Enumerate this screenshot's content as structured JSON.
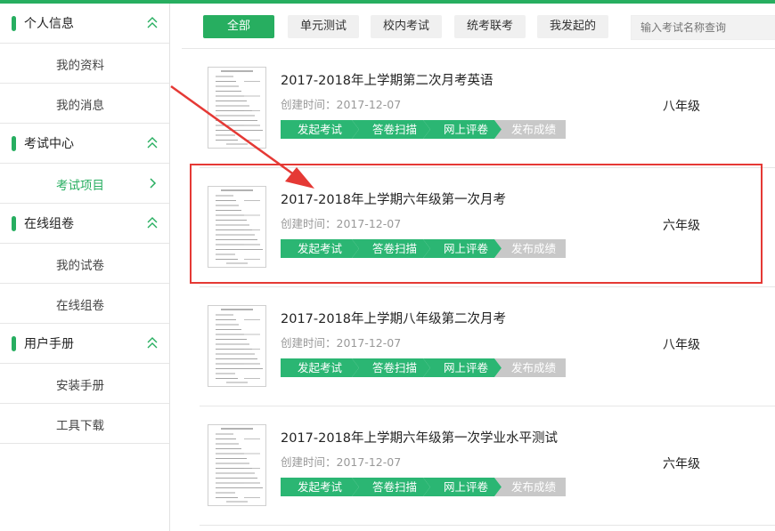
{
  "sidebar": {
    "sections": [
      {
        "label": "个人信息",
        "items": [
          {
            "label": "我的资料",
            "active": false
          },
          {
            "label": "我的消息",
            "active": false
          }
        ]
      },
      {
        "label": "考试中心",
        "items": [
          {
            "label": "考试项目",
            "active": true
          }
        ]
      },
      {
        "label": "在线组卷",
        "items": [
          {
            "label": "我的试卷",
            "active": false
          },
          {
            "label": "在线组卷",
            "active": false
          }
        ]
      },
      {
        "label": "用户手册",
        "items": [
          {
            "label": "安装手册",
            "active": false
          },
          {
            "label": "工具下载",
            "active": false
          }
        ]
      }
    ]
  },
  "filters": {
    "tabs": [
      "全部",
      "单元测试",
      "校内考试",
      "统考联考",
      "我发起的"
    ],
    "active_tab": "全部",
    "search_placeholder": "输入考试名称查询"
  },
  "steps": [
    "发起考试",
    "答卷扫描",
    "网上评卷",
    "发布成绩"
  ],
  "exams": [
    {
      "title": "2017-2018年上学期第二次月考英语",
      "date": "创建时间：2017-12-07",
      "grade": "八年级",
      "completed_steps": 3
    },
    {
      "title": "2017-2018年上学期六年级第一次月考",
      "date": "创建时间：2017-12-07",
      "grade": "六年级",
      "completed_steps": 3
    },
    {
      "title": "2017-2018年上学期八年级第二次月考",
      "date": "创建时间：2017-12-07",
      "grade": "八年级",
      "completed_steps": 3
    },
    {
      "title": "2017-2018年上学期六年级第一次学业水平测试",
      "date": "创建时间：2017-12-07",
      "grade": "六年级",
      "completed_steps": 3
    }
  ],
  "colors": {
    "accent": "#27ae60",
    "step_done": "#2bb673",
    "step_todo": "#c8c8c8",
    "highlight": "#e53935"
  }
}
